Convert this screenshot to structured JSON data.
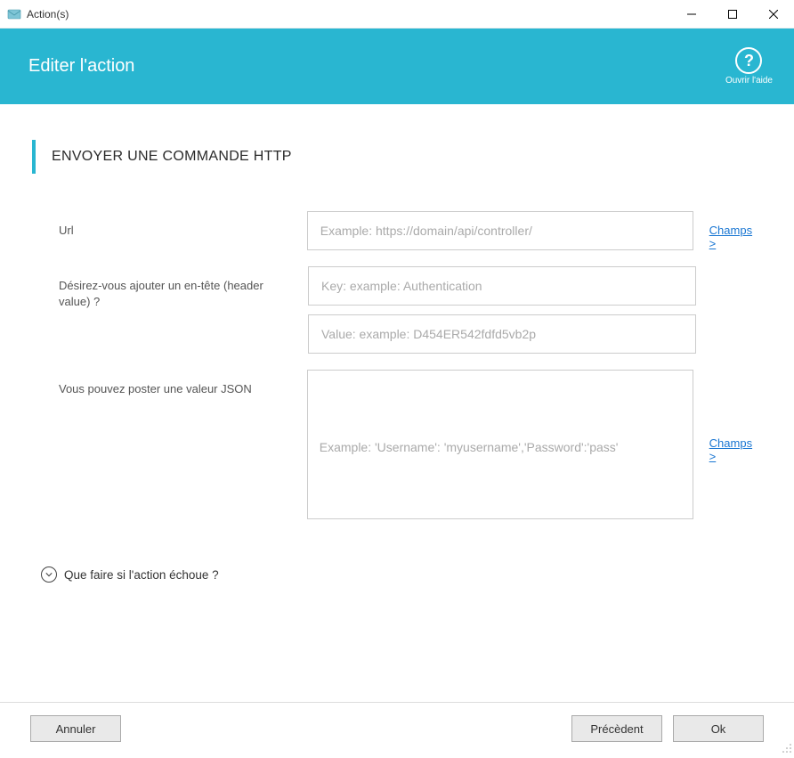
{
  "titlebar": {
    "title": "Action(s)"
  },
  "header": {
    "title": "Editer l'action",
    "help_label": "Ouvrir l'aide"
  },
  "section": {
    "title": "ENVOYER UNE COMMANDE HTTP"
  },
  "form": {
    "url": {
      "label": "Url",
      "placeholder": "Example: https://domain/api/controller/",
      "value": "",
      "link": "Champs >"
    },
    "header_field": {
      "label": "Désirez-vous ajouter un en-tête (header value) ?",
      "key_placeholder": "Key: example: Authentication",
      "key_value": "",
      "value_placeholder": "Value: example: D454ER542fdfd5vb2p",
      "value_value": ""
    },
    "json": {
      "label": "Vous pouvez poster une valeur JSON",
      "placeholder": "Example: 'Username': 'myusername','Password':'pass'",
      "value": "",
      "link": "Champs >"
    }
  },
  "expand": {
    "label": "Que faire si l'action échoue ?"
  },
  "footer": {
    "cancel": "Annuler",
    "previous": "Précèdent",
    "ok": "Ok"
  }
}
